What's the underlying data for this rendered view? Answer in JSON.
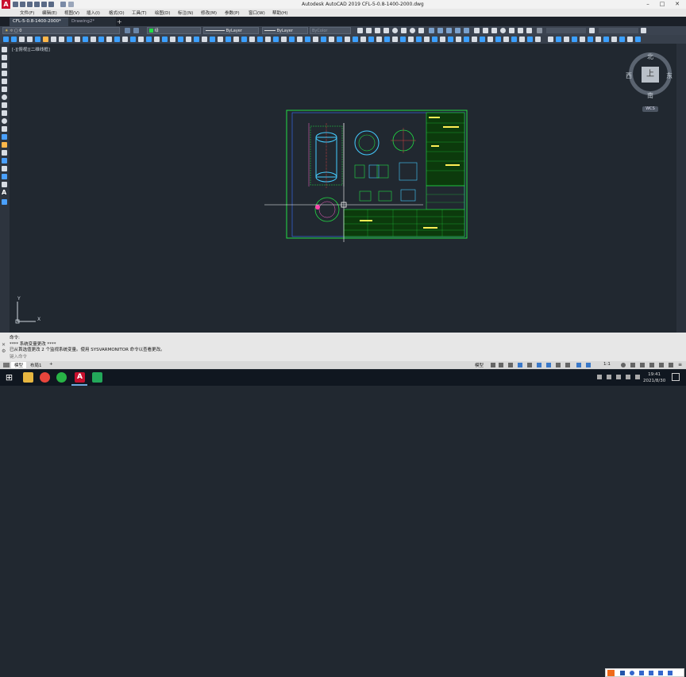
{
  "window": {
    "title": "Autodesk AutoCAD 2019    CFL-5-0.8-1400-2000.dwg",
    "logo_letter": "A"
  },
  "menu": [
    "文件(F)",
    "编辑(E)",
    "视图(V)",
    "插入(I)",
    "格式(O)",
    "工具(T)",
    "绘图(D)",
    "标注(N)",
    "修改(M)",
    "参数(P)",
    "窗口(W)",
    "帮助(H)"
  ],
  "tabs": {
    "active": "CFL-5-0.8-1400-2000*",
    "second": "Drawing2*",
    "add": "+"
  },
  "toolbar": {
    "layer": "0",
    "color": "绿",
    "linetype": "ByLayer",
    "lineweight": "ByLayer",
    "plotstyle": "ByColor"
  },
  "viewport": {
    "label": "[-][俯视][二维线框]"
  },
  "viewcube": {
    "face": "上",
    "north": "北",
    "south": "南",
    "east": "东",
    "west": "西",
    "wcs": "WCS"
  },
  "ucs": {
    "x": "X",
    "y": "Y"
  },
  "command": {
    "label": "命令:",
    "line1": "**** 系统变量更改 ****",
    "line2": "已从首选值更改 2 个监视系统变量。使用 SYSVARMONITOR 命令以查看更改。",
    "placeholder": "键入命令"
  },
  "layouts": [
    "模型",
    "布局1",
    "+"
  ],
  "status": {
    "mode": "模型",
    "scale": "1:1"
  },
  "clock": {
    "time": "19:41",
    "date": "2021/8/30"
  },
  "colors": {
    "drawing_green": "#22dd44",
    "canvas": "#212830",
    "accent_red": "#c8102e"
  }
}
